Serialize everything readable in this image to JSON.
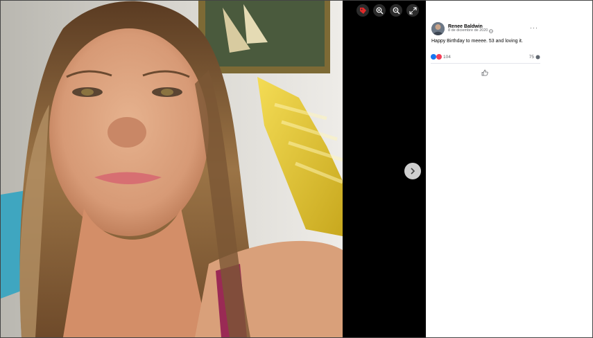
{
  "post": {
    "author": "Renee Baldwin",
    "date": "8 de diciembre de 2020",
    "more_label": "···",
    "caption": "Happy Birthday to meeee. 53 and loving it.",
    "reaction_count": "104",
    "comment_count": "75"
  },
  "icons": {
    "toolbar": [
      "tag-icon",
      "zoom-in-icon",
      "zoom-out-icon",
      "fullscreen-icon"
    ],
    "next": "chevron-right-icon",
    "privacy": "globe-icon",
    "like_action": "thumbs-up-icon"
  },
  "colors": {
    "like_blue": "#1877f2",
    "love_red": "#f33e58",
    "tag_red": "#e02a2a"
  }
}
